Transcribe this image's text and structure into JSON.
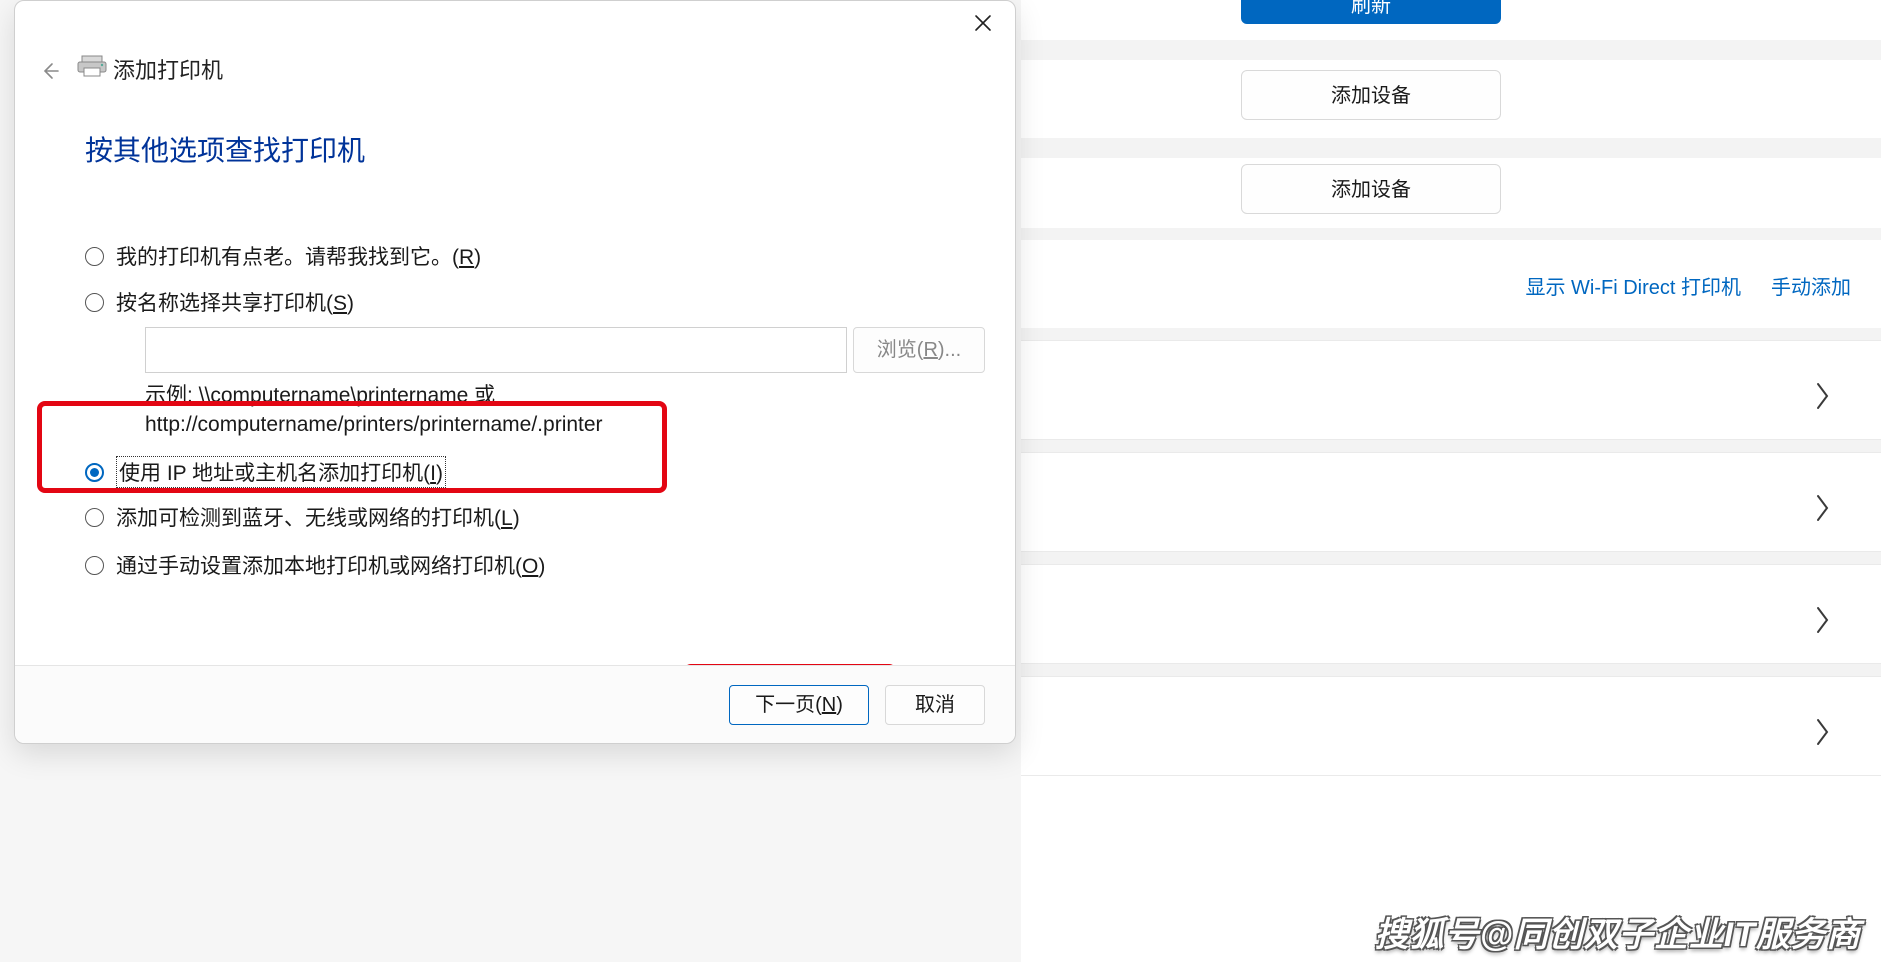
{
  "background": {
    "refresh_label": "刷新",
    "add_device1_label": "添加设备",
    "add_device2_label": "添加设备",
    "link_wifi_direct": "显示 Wi-Fi Direct 打印机",
    "link_manual_add": "手动添加"
  },
  "dialog": {
    "title": "添加打印机",
    "heading": "按其他选项查找打印机",
    "options": {
      "older_printer_pre": "我的打印机有点老。请帮我找到它。(",
      "older_printer_mn": "R",
      "older_printer_post": ")",
      "by_name_pre": "按名称选择共享打印机(",
      "by_name_mn": "S",
      "by_name_post": ")",
      "by_ip_pre": "使用 IP 地址或主机名添加打印机(",
      "by_ip_mn": "I",
      "by_ip_post": ")",
      "wireless_pre": "添加可检测到蓝牙、无线或网络的打印机(",
      "wireless_mn": "L",
      "wireless_post": ")",
      "manual_pre": "通过手动设置添加本地打印机或网络打印机(",
      "manual_mn": "O",
      "manual_post": ")"
    },
    "browse_pre": "浏览(",
    "browse_mn": "R",
    "browse_post": ")...",
    "example_label": "示例: ",
    "example_line1": "\\\\computername\\printername 或",
    "example_line2": "http://computername/printers/printername/.printer",
    "next_pre": "下一页(",
    "next_mn": "N",
    "next_post": ")",
    "cancel_label": "取消"
  },
  "watermark": "搜狐号@同创双子企业IT服务商"
}
